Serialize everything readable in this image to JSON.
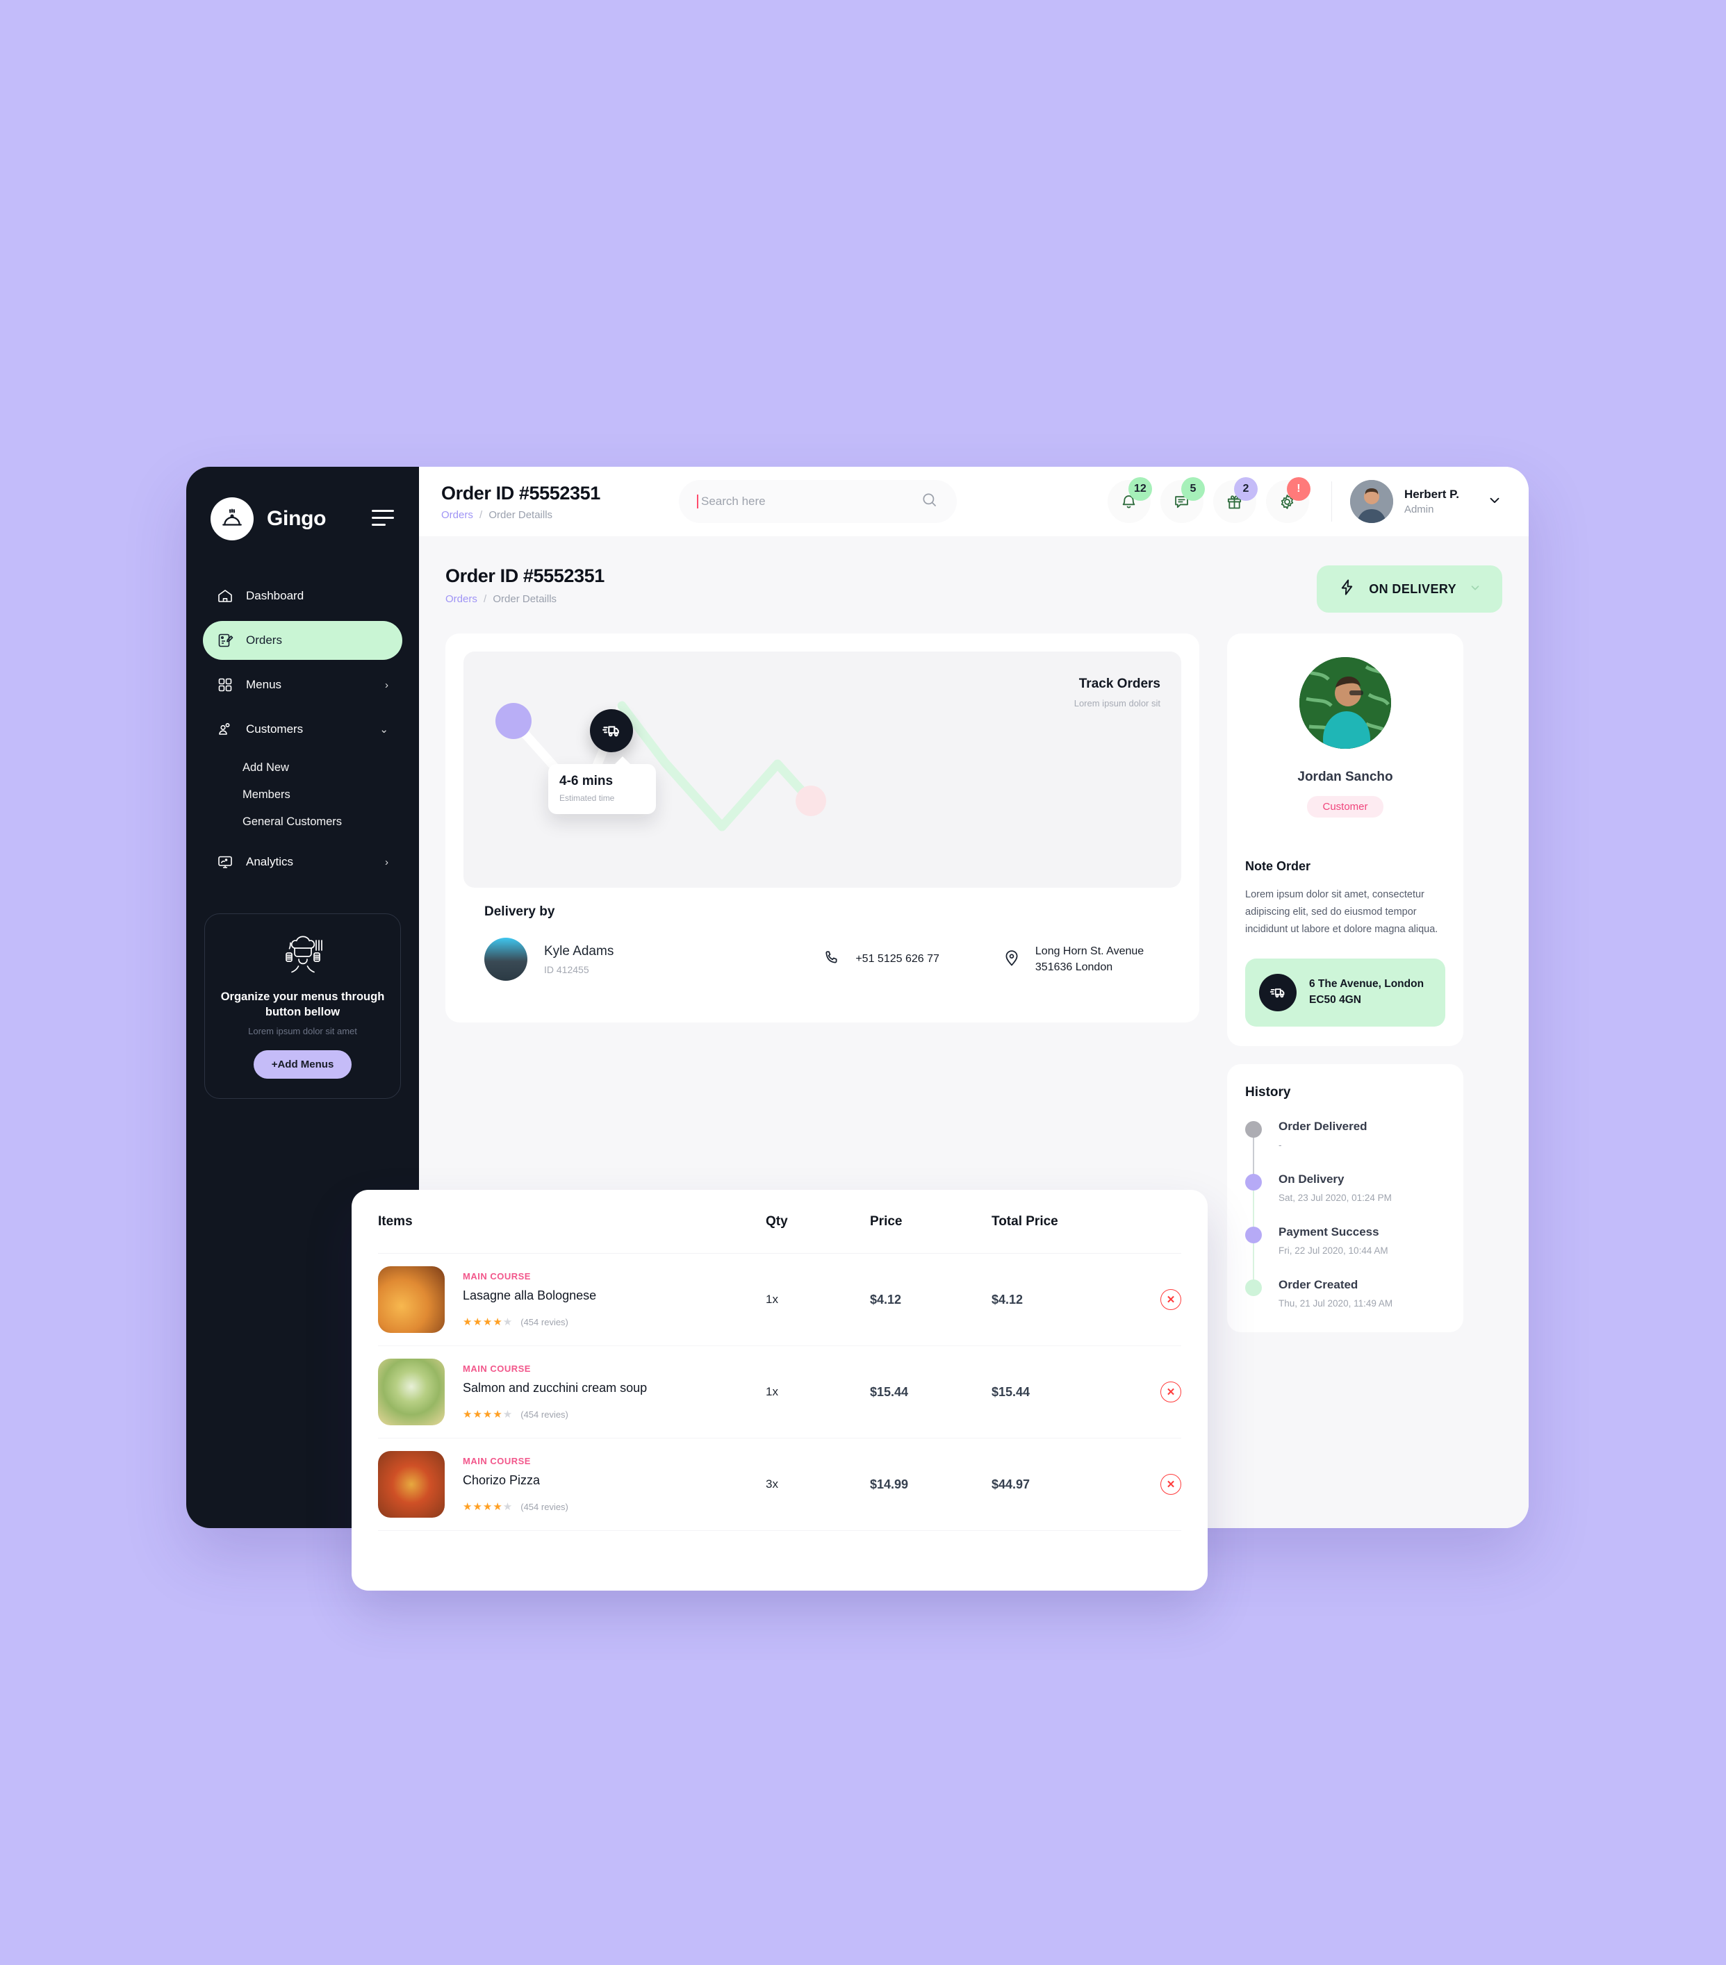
{
  "brand": {
    "name": "Gingo",
    "logo_icon": "cloche-icon"
  },
  "sidebar": {
    "items": [
      {
        "label": "Dashboard",
        "icon": "home-icon",
        "active": false,
        "chevron": ""
      },
      {
        "label": "Orders",
        "icon": "order-edit-icon",
        "active": true,
        "chevron": ""
      },
      {
        "label": "Menus",
        "icon": "grid-icon",
        "active": false,
        "chevron": "›"
      },
      {
        "label": "Customers",
        "icon": "users-icon",
        "active": false,
        "chevron": "⌄"
      },
      {
        "label": "Analytics",
        "icon": "monitor-chart-icon",
        "active": false,
        "chevron": "›"
      }
    ],
    "sub_items": [
      "Add New",
      "Members",
      "General Customers"
    ],
    "promo": {
      "icon": "chef-icon",
      "title": "Organize your menus through button bellow",
      "subtitle": "Lorem ipsum dolor sit amet",
      "button": "+Add Menus"
    }
  },
  "topbar": {
    "title": "Order ID #5552351",
    "breadcrumb": {
      "link": "Orders",
      "sep": "/",
      "current": "Order Detaills"
    },
    "search": {
      "value": "",
      "placeholder": "Search here",
      "icon": "search-icon"
    },
    "notifications": [
      {
        "icon": "bell-icon",
        "count": "12",
        "badge_color": "#a6f0b9"
      },
      {
        "icon": "message-icon",
        "count": "5",
        "badge_color": "#a6f0b9"
      },
      {
        "icon": "gift-icon",
        "count": "2",
        "badge_color": "#c5bcf8"
      },
      {
        "icon": "gear-icon",
        "count": "!",
        "badge_color": "#ff7a7a"
      }
    ],
    "user": {
      "name": "Herbert P.",
      "role": "Admin",
      "avatar": "user-avatar",
      "chevron": "⌄"
    }
  },
  "page": {
    "title": "Order ID #5552351",
    "breadcrumb": {
      "link": "Orders",
      "sep": "/",
      "current": "Order Detaills"
    },
    "status": {
      "icon": "bolt-icon",
      "label": "ON DELIVERY",
      "chevron": "⌄",
      "color": "#cdf5d8"
    }
  },
  "track": {
    "title": "Track Orders",
    "subtitle": "Lorem ipsum dolor sit",
    "truck_icon": "delivery-truck-icon",
    "eta_value": "4-6 mins",
    "eta_label": "Estimated time"
  },
  "delivery": {
    "heading": "Delivery by",
    "courier_name": "Kyle Adams",
    "courier_id": "ID 412455",
    "phone_icon": "phone-icon",
    "phone": "+51 5125 626 77",
    "pin_icon": "location-pin-icon",
    "address_line1": "Long Horn St. Avenue",
    "address_line2": "351636 London"
  },
  "customer": {
    "name": "Jordan Sancho",
    "tag": "Customer",
    "note_heading": "Note Order",
    "note_text": "Lorem ipsum dolor sit amet, consectetur adipiscing elit, sed do eiusmod tempor incididunt ut labore et dolore magna aliqua.",
    "address_icon": "delivery-truck-icon",
    "address_line1": "6 The Avenue, London",
    "address_line2": "EC50 4GN"
  },
  "history": {
    "heading": "History",
    "events": [
      {
        "title": "Order Delivered",
        "time": "-",
        "dot": "#adadb3",
        "line": "#c9ccd2"
      },
      {
        "title": "On Delivery",
        "time": "Sat, 23 Jul 2020, 01:24 PM",
        "dot": "#b6aaf6",
        "line": "#d8f3df"
      },
      {
        "title": "Payment Success",
        "time": "Fri, 22 Jul 2020, 10:44 AM",
        "dot": "#b6aaf6",
        "line": "#d8f3df"
      },
      {
        "title": "Order Created",
        "time": "Thu, 21 Jul 2020, 11:49 AM",
        "dot": "#cef3d9",
        "line": ""
      }
    ]
  },
  "items_table": {
    "columns": [
      "Items",
      "Qty",
      "Price",
      "Total Price"
    ],
    "rows": [
      {
        "category": "MAIN COURSE",
        "name": "Lasagne alla Bolognese",
        "stars_on": 4,
        "stars_off": 1,
        "reviews": "(454 revies)",
        "qty": "1x",
        "price": "$4.12",
        "total": "$4.12",
        "img_class": "f-lasagna",
        "delete_icon": "remove-item-icon"
      },
      {
        "category": "MAIN COURSE",
        "name": "Salmon and zucchini cream soup",
        "stars_on": 4,
        "stars_off": 1,
        "reviews": "(454 revies)",
        "qty": "1x",
        "price": "$15.44",
        "total": "$15.44",
        "img_class": "f-soup",
        "delete_icon": "remove-item-icon"
      },
      {
        "category": "MAIN COURSE",
        "name": "Chorizo Pizza",
        "stars_on": 4,
        "stars_off": 1,
        "reviews": "(454 revies)",
        "qty": "3x",
        "price": "$14.99",
        "total": "$44.97",
        "img_class": "f-pizza",
        "delete_icon": "remove-item-icon"
      }
    ]
  },
  "chart_data": {
    "type": "line",
    "title": "Track Orders",
    "subtitle": "Lorem ipsum dolor sit",
    "x": [
      0,
      1,
      2,
      3,
      4,
      5
    ],
    "series": [
      {
        "name": "Completed route",
        "values": [
          72,
          20,
          80,
          8,
          55,
          12
        ],
        "color": "#ffffff"
      },
      {
        "name": "Remaining route",
        "values": [
          null,
          null,
          80,
          8,
          55,
          12
        ],
        "color": "#d6f5de"
      }
    ],
    "annotations": [
      {
        "label": "4-6 mins",
        "sublabel": "Estimated time",
        "at_x": 2
      }
    ],
    "markers": [
      {
        "name": "origin",
        "color": "#b9aef6",
        "at_x": 0
      },
      {
        "name": "current-vehicle",
        "color": "#121722",
        "at_x": 2
      },
      {
        "name": "destination",
        "color": "#fbe3e6",
        "at_x": 5
      }
    ],
    "grid": false,
    "legend": "none"
  },
  "theme": {
    "page_bg": "#c3bcfa",
    "sidebar_bg": "#111620",
    "accent_green": "#cdf5d8",
    "accent_purple": "#c5bcf8",
    "accent_pink": "#f2578b"
  }
}
